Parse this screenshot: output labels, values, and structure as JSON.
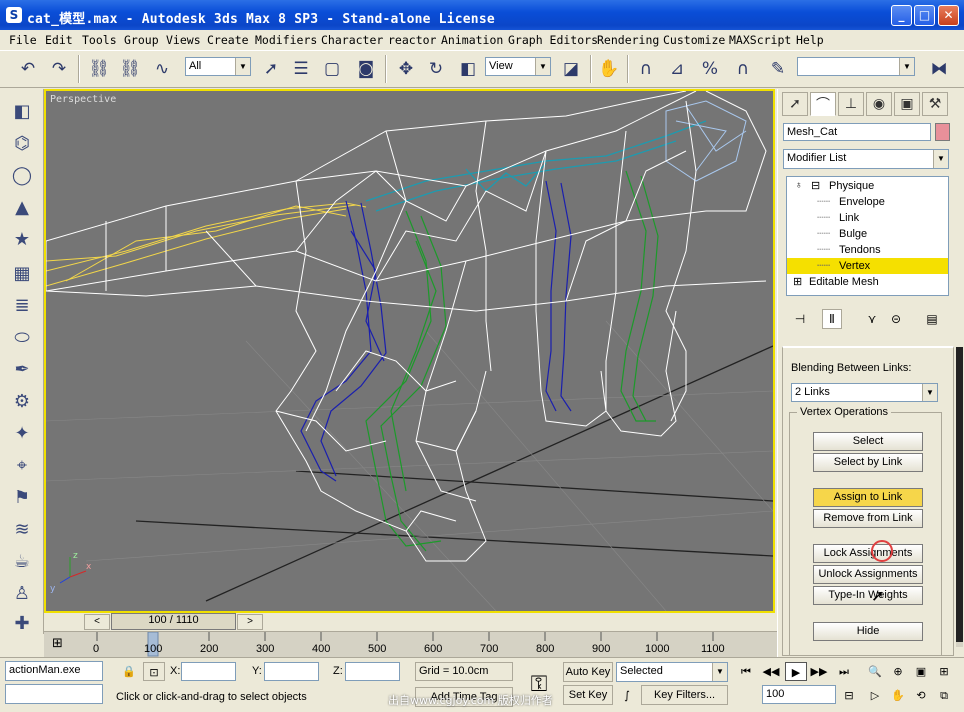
{
  "window": {
    "title": "cat_模型.max - Autodesk 3ds Max 8 SP3  - Stand-alone License",
    "app_icon": "3ds-max-icon",
    "minimize": "_",
    "maximize": "□",
    "close": "✕"
  },
  "menu": [
    "File",
    "Edit",
    "Tools",
    "Group",
    "Views",
    "Create",
    "Modifiers",
    "Character",
    "reactor",
    "Animation",
    "Graph Editors",
    "Rendering",
    "Customize",
    "MAXScript",
    "Help"
  ],
  "toolbar": {
    "selection_filter": "All",
    "reference_coord": "View",
    "named_selection": ""
  },
  "viewport": {
    "label": "Perspective",
    "axis_x": "x",
    "axis_y": "y",
    "axis_z": "z",
    "border_color": "#f0e000"
  },
  "timeline": {
    "slider_label": "100 / 1110",
    "ticks": [
      "0",
      "100",
      "200",
      "300",
      "400",
      "500",
      "600",
      "700",
      "800",
      "900",
      "1000",
      "1100"
    ],
    "prev": "<",
    "next": ">"
  },
  "command_panel": {
    "object_name": "Mesh_Cat",
    "object_color": "#e8909a",
    "modifier_list": "Modifier List",
    "stack": [
      {
        "label": "Physique",
        "level": 0,
        "selected": false,
        "expand": "⊟",
        "bulb": "💡"
      },
      {
        "label": "Envelope",
        "level": 1,
        "selected": false
      },
      {
        "label": "Link",
        "level": 1,
        "selected": false
      },
      {
        "label": "Bulge",
        "level": 1,
        "selected": false
      },
      {
        "label": "Tendons",
        "level": 1,
        "selected": false
      },
      {
        "label": "Vertex",
        "level": 1,
        "selected": true
      },
      {
        "label": "Editable Mesh",
        "level": 0,
        "selected": false,
        "expand": "⊞"
      }
    ],
    "blending_label": "Blending Between Links:",
    "blending_value": "2 Links",
    "vertex_ops_label": "Vertex Operations",
    "buttons": [
      {
        "label": "Select",
        "active": false
      },
      {
        "label": "Select by Link",
        "active": false
      },
      {
        "label": "Assign to Link",
        "active": true
      },
      {
        "label": "Remove from Link",
        "active": false
      },
      {
        "label": "Lock Assignments",
        "active": false
      },
      {
        "label": "Unlock Assignments",
        "active": false
      },
      {
        "label": "Type-In Weights",
        "active": false
      },
      {
        "label": "Hide",
        "active": false
      }
    ]
  },
  "status": {
    "script_listener": "actionMan.exe",
    "script_input": "",
    "x_label": "X:",
    "y_label": "Y:",
    "z_label": "Z:",
    "x_value": "",
    "y_value": "",
    "z_value": "",
    "grid": "Grid = 10.0cm",
    "prompt": "Click or click-and-drag to select objects",
    "add_time_tag": "Add Time Tag",
    "auto_key": "Auto Key",
    "set_key": "Set Key",
    "key_mode": "Selected",
    "key_filters": "Key Filters...",
    "current_frame": "100",
    "watermark": "出自www.cgjoy.com 版权归作者"
  }
}
